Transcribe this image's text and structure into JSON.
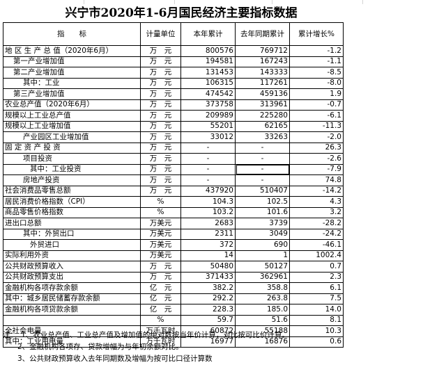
{
  "title": "兴宁市2020年1-6月国民经济主要指标数据",
  "headers": {
    "indicator": "指　　标",
    "unit": "计量单位",
    "current": "本年累计",
    "last_year": "去年同期累计",
    "growth": "累计增长%"
  },
  "rows": [
    {
      "name": "地 区 生 产 总 值（2020年6月）",
      "indent": 0,
      "unit": "万　元",
      "current": "800576",
      "last": "769712",
      "growth": "-1.2"
    },
    {
      "name": "第一产业增加值",
      "indent": 1,
      "unit": "万　元",
      "current": "194581",
      "last": "167243",
      "growth": "-1.1"
    },
    {
      "name": "第二产业增加值",
      "indent": 1,
      "unit": "万　元",
      "current": "131453",
      "last": "143333",
      "growth": "-8.5"
    },
    {
      "name": "其中：工业",
      "indent": 2,
      "unit": "万　元",
      "current": "106315",
      "last": "117261",
      "growth": "-8.0"
    },
    {
      "name": "第三产业增加值",
      "indent": 1,
      "unit": "万　元",
      "current": "474542",
      "last": "459136",
      "growth": "1.9"
    },
    {
      "name": "农业总产值（2020年6月）",
      "indent": 0,
      "unit": "万　元",
      "current": "373758",
      "last": "313961",
      "growth": "-0.7"
    },
    {
      "name": "规模以上工业总产值",
      "indent": 0,
      "unit": "万　元",
      "current": "209989",
      "last": "225280",
      "growth": "-6.1"
    },
    {
      "name": "规模以上工业增加值",
      "indent": 0,
      "unit": "万　元",
      "current": "55201",
      "last": "62165",
      "growth": "-11.3"
    },
    {
      "name": "产业园区工业增加值",
      "indent": 2,
      "unit": "万　元",
      "current": "33012",
      "last": "33263",
      "growth": "-2.0"
    },
    {
      "name": "固 定 资 产 投 资",
      "indent": 0,
      "unit": "万　元",
      "current": "-",
      "last": "-",
      "growth": "26.3"
    },
    {
      "name": "项目投资",
      "indent": 2,
      "unit": "万　元",
      "current": "-",
      "last": "-",
      "growth": "-2.6"
    },
    {
      "name": "其中：工业投资",
      "indent": 3,
      "unit": "万　元",
      "current": "-",
      "last": "-",
      "growth": "-7.9"
    },
    {
      "name": "房地产投资",
      "indent": 2,
      "unit": "万　元",
      "current": "-",
      "last": "-",
      "growth": "74.8"
    },
    {
      "name": "社会消费品零售总额",
      "indent": 0,
      "unit": "万　元",
      "current": "437920",
      "last": "510407",
      "growth": "-14.2"
    },
    {
      "name": "居民消费价格指数（CPI）",
      "indent": 0,
      "unit": "%",
      "current": "104.3",
      "last": "102.5",
      "growth": "4.3"
    },
    {
      "name": "商品零售价格指数",
      "indent": 0,
      "unit": "%",
      "current": "103.2",
      "last": "101.6",
      "growth": "3.2"
    },
    {
      "name": "进出口总额",
      "indent": 0,
      "unit": "万美元",
      "current": "2683",
      "last": "3739",
      "growth": "-28.2"
    },
    {
      "name": "其中：外贸出口",
      "indent": 2,
      "unit": "万美元",
      "current": "2311",
      "last": "3049",
      "growth": "-24.2"
    },
    {
      "name": "外贸进口",
      "indent": 3,
      "unit": "万美元",
      "current": "372",
      "last": "690",
      "growth": "-46.1"
    },
    {
      "name": "实际利用外资",
      "indent": 0,
      "unit": "万美元",
      "current": "14",
      "last": "1",
      "growth": "1002.4"
    },
    {
      "name": "公共财政预算收入",
      "indent": 0,
      "unit": "万　元",
      "current": "50480",
      "last": "50127",
      "growth": "0.7"
    },
    {
      "name": "公共财政预算支出",
      "indent": 0,
      "unit": "万　元",
      "current": "371433",
      "last": "362961",
      "growth": "2.3"
    },
    {
      "name": "金融机构各项存款余额",
      "indent": 0,
      "unit": "亿　元",
      "current": "382.2",
      "last": "358.8",
      "growth": "6.1"
    },
    {
      "name": "其中：城乡居民储蓄存款余额",
      "indent": 0,
      "unit": "亿　元",
      "current": "292.2",
      "last": "263.8",
      "growth": "7.5"
    },
    {
      "name": "金融机构各项贷款余额",
      "indent": 0,
      "unit": "亿　元",
      "current": "228.3",
      "last": "185.0",
      "growth": "14.0"
    },
    {
      "name": "",
      "indent": 0,
      "unit": "%",
      "current": "59.7",
      "last": "51.6",
      "growth": "8.1"
    },
    {
      "name": "全社会电量",
      "indent": 0,
      "unit": "万千瓦时",
      "current": "60872",
      "last": "55188",
      "growth": "10.3"
    },
    {
      "name": "其中：工业用电量",
      "indent": 0,
      "unit": "万千瓦时",
      "current": "16977",
      "last": "16876",
      "growth": "0.6"
    }
  ],
  "notes": [
    "注：　1、农业总产值、工业总产值及增加值的绝对数按当年价计算，对比按可比价计算。",
    "　　2、金融机构各项存、贷款增幅为与年初余额对比。",
    "　　3、公共财政预算收入去年同期数及增幅为按可比口径计算数"
  ]
}
